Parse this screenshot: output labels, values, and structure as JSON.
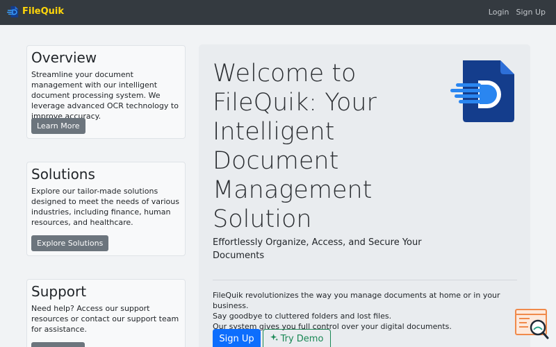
{
  "nav": {
    "brand": "FileQuik",
    "links": [
      "Login",
      "Sign Up"
    ]
  },
  "cards": [
    {
      "title": "Overview",
      "text": "Streamline your document management with our intelligent document processing system. We leverage advanced OCR technology to improve accuracy.",
      "button": "Learn More"
    },
    {
      "title": "Solutions",
      "text": "Explore our tailor-made solutions designed to meet the needs of various industries, including finance, human resources, and healthcare.",
      "button": "Explore Solutions"
    },
    {
      "title": "Support",
      "text": "Need help? Access our support resources or contact our support team for assistance.",
      "button": ""
    }
  ],
  "hero": {
    "title": "Welcome to FileQuik: Your Intelligent Document Management Solution",
    "subtitle": "Effortlessly Organize, Access, and Secure Your Documents",
    "description": [
      "FileQuik revolutionizes the way you manage documents at home or in your business.",
      "Say goodbye to cluttered folders and lost files.",
      "Our system gives you full control over your digital documents."
    ],
    "primary_button": "Sign Up",
    "secondary_button": "Try Demo"
  },
  "colors": {
    "navbar": "#343a40",
    "brand": "#ffd60a",
    "primary": "#0d6efd",
    "success": "#198754",
    "secondary": "#6c757d"
  },
  "icons": {
    "brand_logo": "document-logo-icon",
    "try_demo": "sparkle-icon",
    "floating": "search-document-icon"
  }
}
